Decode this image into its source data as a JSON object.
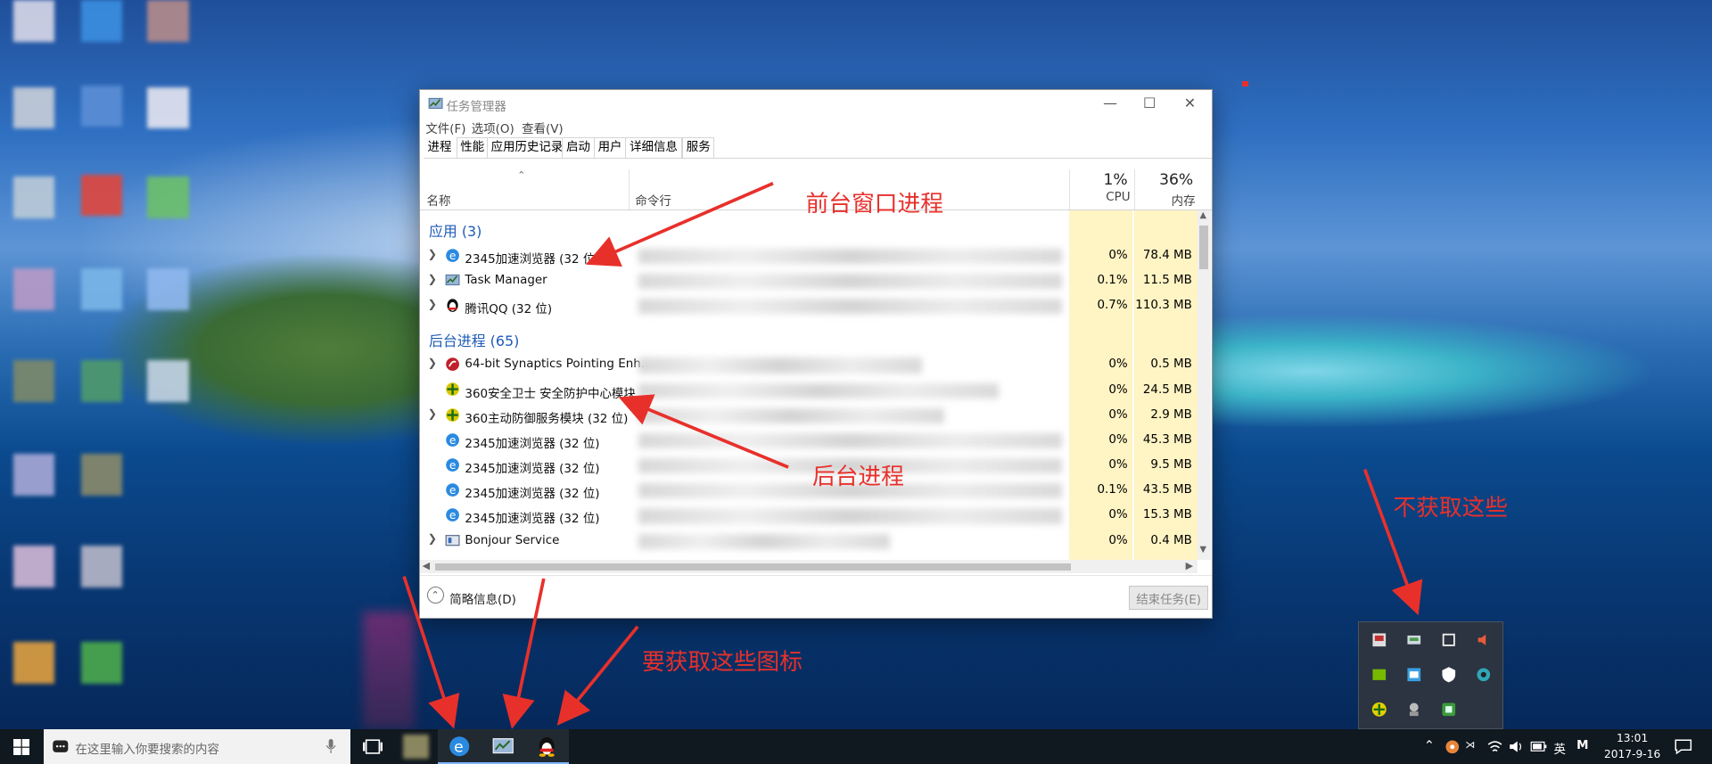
{
  "window": {
    "title": "任务管理器",
    "menu": [
      "文件(F)",
      "选项(O)",
      "查看(V)"
    ],
    "tabs": [
      "进程",
      "性能",
      "应用历史记录",
      "启动",
      "用户",
      "详细信息",
      "服务"
    ],
    "columns": {
      "name": "名称",
      "command": "命令行",
      "cpu_pct": "1%",
      "cpu_label": "CPU",
      "mem_pct": "36%",
      "mem_label": "内存"
    },
    "apps_group": "应用 (3)",
    "apps": [
      {
        "name": "2345加速浏览器 (32 位)",
        "cpu": "0%",
        "mem": "78.4 MB",
        "icon": "ie-icon"
      },
      {
        "name": "Task Manager",
        "cpu": "0.1%",
        "mem": "11.5 MB",
        "icon": "task-manager-icon"
      },
      {
        "name": "腾讯QQ (32 位)",
        "cpu": "0.7%",
        "mem": "110.3 MB",
        "icon": "qq-penguin-icon"
      }
    ],
    "bg_group": "后台进程 (65)",
    "bg": [
      {
        "name": "64-bit Synaptics Pointing Enh...",
        "cpu": "0%",
        "mem": "0.5 MB",
        "icon": "synaptics-icon"
      },
      {
        "name": "360安全卫士 安全防护中心模块...",
        "cpu": "0%",
        "mem": "24.5 MB",
        "icon": "360-icon"
      },
      {
        "name": "360主动防御服务模块 (32 位)",
        "cpu": "0%",
        "mem": "2.9 MB",
        "icon": "360-icon"
      },
      {
        "name": "2345加速浏览器 (32 位)",
        "cpu": "0%",
        "mem": "45.3 MB",
        "icon": "ie-icon"
      },
      {
        "name": "2345加速浏览器 (32 位)",
        "cpu": "0%",
        "mem": "9.5 MB",
        "icon": "ie-icon"
      },
      {
        "name": "2345加速浏览器 (32 位)",
        "cpu": "0.1%",
        "mem": "43.5 MB",
        "icon": "ie-icon"
      },
      {
        "name": "2345加速浏览器 (32 位)",
        "cpu": "0%",
        "mem": "15.3 MB",
        "icon": "ie-icon"
      },
      {
        "name": "Bonjour Service",
        "cpu": "0%",
        "mem": "0.4 MB",
        "icon": "service-icon"
      }
    ],
    "footer_details": "简略信息(D)",
    "end_task": "结束任务(E)"
  },
  "annotations": {
    "foreground": "前台窗口进程",
    "background": "后台进程",
    "ignore": "不获取这些",
    "get_icons": "要获取这些图标"
  },
  "taskbar": {
    "search_placeholder": "在这里输入你要搜索的内容",
    "ime": "英",
    "ime2": "M",
    "time": "13:01",
    "date": "2017-9-16"
  },
  "colors": {
    "accent_blue": "#1e5bb8",
    "annotation_red": "#e8302b",
    "cpu_highlight": "#fff4c4"
  }
}
